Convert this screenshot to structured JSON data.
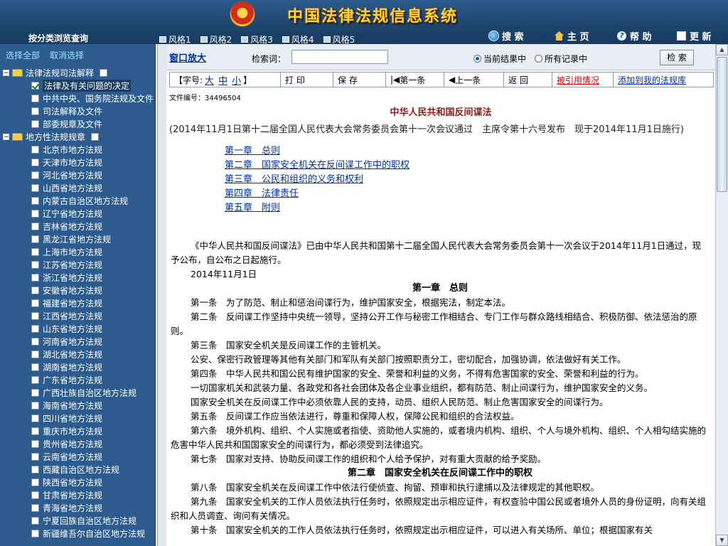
{
  "header": {
    "system_title": "中国法律法规信息系统",
    "browse_title": "按分类浏览查询",
    "styles": [
      "风格1",
      "风格2",
      "风格3",
      "风格4",
      "风格5"
    ],
    "links": {
      "search": "搜 索",
      "home": "主 页",
      "help": "帮 助",
      "update": "更 新"
    },
    "icons": [
      "emblem-icon",
      "search-icon",
      "home-icon",
      "help-icon",
      "update-icon"
    ]
  },
  "sidebar": {
    "select_all": "选择全部",
    "cancel_select": "取消选择",
    "groups": [
      {
        "label": "法律法规司法解释",
        "expanded": true,
        "items": [
          {
            "label": "法律及有关问题的决定",
            "checked": true
          },
          {
            "label": "中共中央、国务院法规及文件",
            "checked": false
          },
          {
            "label": "司法解释及文件",
            "checked": false
          },
          {
            "label": "部委规章及文件",
            "checked": false
          }
        ]
      },
      {
        "label": "地方性法规规章",
        "expanded": true,
        "items": [
          {
            "label": "北京市地方法规",
            "checked": false
          },
          {
            "label": "天津市地方法规",
            "checked": false
          },
          {
            "label": "河北省地方法规",
            "checked": false
          },
          {
            "label": "山西省地方法规",
            "checked": false
          },
          {
            "label": "内蒙古自治区地方法规",
            "checked": false
          },
          {
            "label": "辽宁省地方法规",
            "checked": false
          },
          {
            "label": "吉林省地方法规",
            "checked": false
          },
          {
            "label": "黑龙江省地方法规",
            "checked": false
          },
          {
            "label": "上海市地方法规",
            "checked": false
          },
          {
            "label": "江苏省地方法规",
            "checked": false
          },
          {
            "label": "浙江省地方法规",
            "checked": false
          },
          {
            "label": "安徽省地方法规",
            "checked": false
          },
          {
            "label": "福建省地方法规",
            "checked": false
          },
          {
            "label": "江西省地方法规",
            "checked": false
          },
          {
            "label": "山东省地方法规",
            "checked": false
          },
          {
            "label": "河南省地方法规",
            "checked": false
          },
          {
            "label": "湖北省地方法规",
            "checked": false
          },
          {
            "label": "湖南省地方法规",
            "checked": false
          },
          {
            "label": "广东省地方法规",
            "checked": false
          },
          {
            "label": "广西壮族自治区地方法规",
            "checked": false
          },
          {
            "label": "海南省地方法规",
            "checked": false
          },
          {
            "label": "四川省地方法规",
            "checked": false
          },
          {
            "label": "重庆市地方法规",
            "checked": false
          },
          {
            "label": "贵州省地方法规",
            "checked": false
          },
          {
            "label": "云南省地方法规",
            "checked": false
          },
          {
            "label": "西藏自治区地方法规",
            "checked": false
          },
          {
            "label": "陕西省地方法规",
            "checked": false
          },
          {
            "label": "甘肃省地方法规",
            "checked": false
          },
          {
            "label": "青海省地方法规",
            "checked": false
          },
          {
            "label": "宁夏回族自治区地方法规",
            "checked": false
          },
          {
            "label": "新疆维吾尔自治区地方法规",
            "checked": false
          }
        ]
      }
    ]
  },
  "search": {
    "zoom_label": "窗口放大",
    "keyword_label": "检索词：",
    "keyword_value": "",
    "option_current": "当前结果中",
    "option_all": "所有记录中",
    "selected_option": "current",
    "button_label": "检 索"
  },
  "toolbar": {
    "font_prefix": "【字号:",
    "font_large": "大",
    "font_medium": "中",
    "font_small": "小",
    "font_suffix": "】",
    "print": "打 印",
    "save": "保 存",
    "first": "第一条",
    "prev": "上一条",
    "back": "返 回",
    "cited": "被引用情况",
    "add_to_library": "添加到我的法规库"
  },
  "document": {
    "doc_number": "文件编号：34496504",
    "title": "中华人民共和国反间谍法",
    "subtitle": "(2014年11月1日第十二届全国人民代表大会常务委员会第十一次会议通过　主席令第十六号发布　现于2014年11月1日施行)",
    "toc": [
      "第一章　总则",
      "第二章　国家安全机关在反间谍工作中的职权",
      "第三章　公民和组织的义务和权利",
      "第四章　法律责任",
      "第五章　附则"
    ],
    "paragraphs": [
      {
        "type": "p",
        "text": "《中华人民共和国反间谍法》已由中华人民共和国第十二届全国人民代表大会常务委员会第十一次会议于2014年11月1日通过，现予公布，自公布之日起施行。"
      },
      {
        "type": "date",
        "text": "2014年11月1日"
      },
      {
        "type": "chap",
        "text": "第一章　总则"
      },
      {
        "type": "p",
        "text": "第一条　为了防范、制止和惩治间谍行为，维护国家安全，根据宪法，制定本法。"
      },
      {
        "type": "p",
        "text": "第二条　反间谍工作坚持中央统一领导，坚持公开工作与秘密工作相结合、专门工作与群众路线相结合、积极防御、依法惩治的原则。"
      },
      {
        "type": "p",
        "text": "第三条　国家安全机关是反间谍工作的主管机关。"
      },
      {
        "type": "p",
        "text": "公安、保密行政管理等其他有关部门和军队有关部门按照职责分工，密切配合，加强协调，依法做好有关工作。"
      },
      {
        "type": "p",
        "text": "第四条　中华人民共和国公民有维护国家的安全、荣誉和利益的义务，不得有危害国家的安全、荣誉和利益的行为。"
      },
      {
        "type": "p",
        "text": "一切国家机关和武装力量、各政党和各社会团体及各企业事业组织，都有防范、制止间谍行为，维护国家安全的义务。"
      },
      {
        "type": "p",
        "text": "国家安全机关在反间谍工作中必须依靠人民的支持，动员、组织人民防范、制止危害国家安全的间谍行为。"
      },
      {
        "type": "p",
        "text": "第五条　反间谍工作应当依法进行，尊重和保障人权，保障公民和组织的合法权益。"
      },
      {
        "type": "p",
        "text": "第六条　境外机构、组织、个人实施或者指使、资助他人实施的，或者境内机构、组织、个人与境外机构、组织、个人相勾结实施的危害中华人民共和国国家安全的间谍行为，都必须受到法律追究。"
      },
      {
        "type": "p",
        "text": "第七条　国家对支持、协助反间谍工作的组织和个人给予保护，对有重大贡献的给予奖励。"
      },
      {
        "type": "chap",
        "text": "第二章　国家安全机关在反间谍工作中的职权"
      },
      {
        "type": "p",
        "text": "第八条　国家安全机关在反间谍工作中依法行使侦查、拘留、预审和执行逮捕以及法律规定的其他职权。"
      },
      {
        "type": "p",
        "text": "第九条　国家安全机关的工作人员依法执行任务时，依照规定出示相应证件，有权查验中国公民或者境外人员的身份证明，向有关组织和人员调查、询问有关情况。"
      },
      {
        "type": "p",
        "text": "第十条　国家安全机关的工作人员依法执行任务时，依照规定出示相应证件，可以进入有关场所、单位；根据国家有关"
      }
    ]
  }
}
